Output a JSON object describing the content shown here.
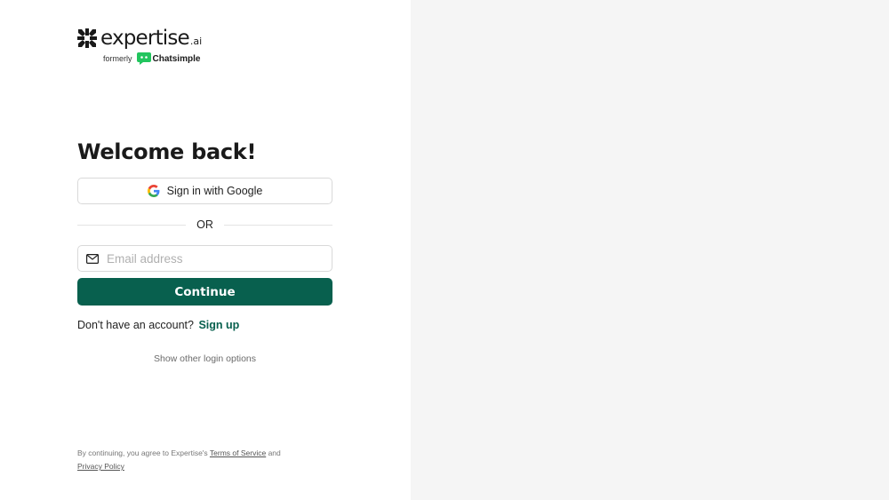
{
  "brand": {
    "name": "expertise",
    "suffix": ".ai",
    "formerly_label": "formerly",
    "former_name": "Chatsimple",
    "accent_color": "#08604e",
    "former_brand_color": "#22c55e"
  },
  "login": {
    "title": "Welcome back!",
    "google_button_label": "Sign in with Google",
    "divider_text": "OR",
    "email_placeholder": "Email address",
    "email_value": "",
    "continue_label": "Continue",
    "no_account_text": "Don't have an account?",
    "signup_label": "Sign up",
    "other_options_label": "Show other login options"
  },
  "legal": {
    "prefix": "By continuing, you agree to Expertise's",
    "terms_label": "Terms of Service",
    "conjunction": "and",
    "privacy_label": "Privacy Policy"
  },
  "icons": {
    "logo": "expertise-asterisk-logo-icon",
    "former_logo": "chatsimple-chat-bubble-icon",
    "google": "google-g-icon",
    "email": "mail-envelope-icon"
  }
}
